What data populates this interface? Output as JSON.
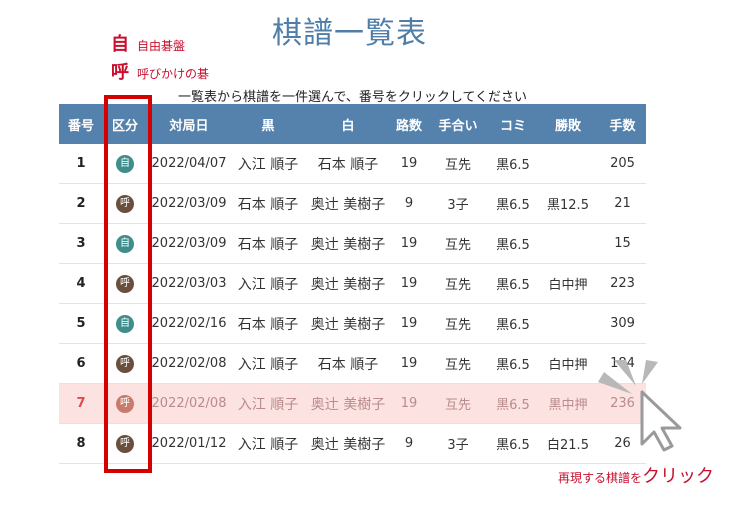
{
  "title": "棋譜一覧表",
  "legend": [
    {
      "symbol": "自",
      "text": "自由碁盤"
    },
    {
      "symbol": "呼",
      "text": "呼びかけの碁"
    }
  ],
  "instruction": "一覧表から棋譜を一件選んで、番号をクリックしてください",
  "table": {
    "headers": [
      "番号",
      "区分",
      "対局日",
      "黒",
      "白",
      "路数",
      "手合い",
      "コミ",
      "勝敗",
      "手数"
    ],
    "rows": [
      {
        "no": "1",
        "type": "自",
        "date": "2022/04/07",
        "black": "入江 順子",
        "white": "石本 順子",
        "size": "19",
        "handicap": "互先",
        "komi": "黒6.5",
        "result": "",
        "moves": "205"
      },
      {
        "no": "2",
        "type": "呼",
        "date": "2022/03/09",
        "black": "石本 順子",
        "white": "奥辻 美樹子",
        "size": "9",
        "handicap": "3子",
        "komi": "黒6.5",
        "result": "黒12.5",
        "moves": "21"
      },
      {
        "no": "3",
        "type": "自",
        "date": "2022/03/09",
        "black": "石本 順子",
        "white": "奥辻 美樹子",
        "size": "19",
        "handicap": "互先",
        "komi": "黒6.5",
        "result": "",
        "moves": "15"
      },
      {
        "no": "4",
        "type": "呼",
        "date": "2022/03/03",
        "black": "入江 順子",
        "white": "奥辻 美樹子",
        "size": "19",
        "handicap": "互先",
        "komi": "黒6.5",
        "result": "白中押",
        "moves": "223"
      },
      {
        "no": "5",
        "type": "自",
        "date": "2022/02/16",
        "black": "石本 順子",
        "white": "奥辻 美樹子",
        "size": "19",
        "handicap": "互先",
        "komi": "黒6.5",
        "result": "",
        "moves": "309"
      },
      {
        "no": "6",
        "type": "呼",
        "date": "2022/02/08",
        "black": "入江 順子",
        "white": "石本 順子",
        "size": "19",
        "handicap": "互先",
        "komi": "黒6.5",
        "result": "白中押",
        "moves": "184"
      },
      {
        "no": "7",
        "type": "呼",
        "date": "2022/02/08",
        "black": "入江 順子",
        "white": "奥辻 美樹子",
        "size": "19",
        "handicap": "互先",
        "komi": "黒6.5",
        "result": "黒中押",
        "moves": "236"
      },
      {
        "no": "8",
        "type": "呼",
        "date": "2022/01/12",
        "black": "入江 順子",
        "white": "奥辻 美樹子",
        "size": "9",
        "handicap": "3子",
        "komi": "黒6.5",
        "result": "白21.5",
        "moves": "26"
      }
    ],
    "highlighted_row": "7"
  },
  "bottom_note": {
    "small": "再現する棋譜を",
    "big": "クリック"
  },
  "colors": {
    "title": "#4f7ea8",
    "header_bg": "#5581ad",
    "badge_jiyu": "#3f8e8c",
    "badge_yobi": "#6b4e3d",
    "highlight_bg": "#fde2e2",
    "frame": "#d50000",
    "accent_red": "#c8102e"
  },
  "icons": {
    "cursor": "mouse-pointer-click-icon"
  }
}
